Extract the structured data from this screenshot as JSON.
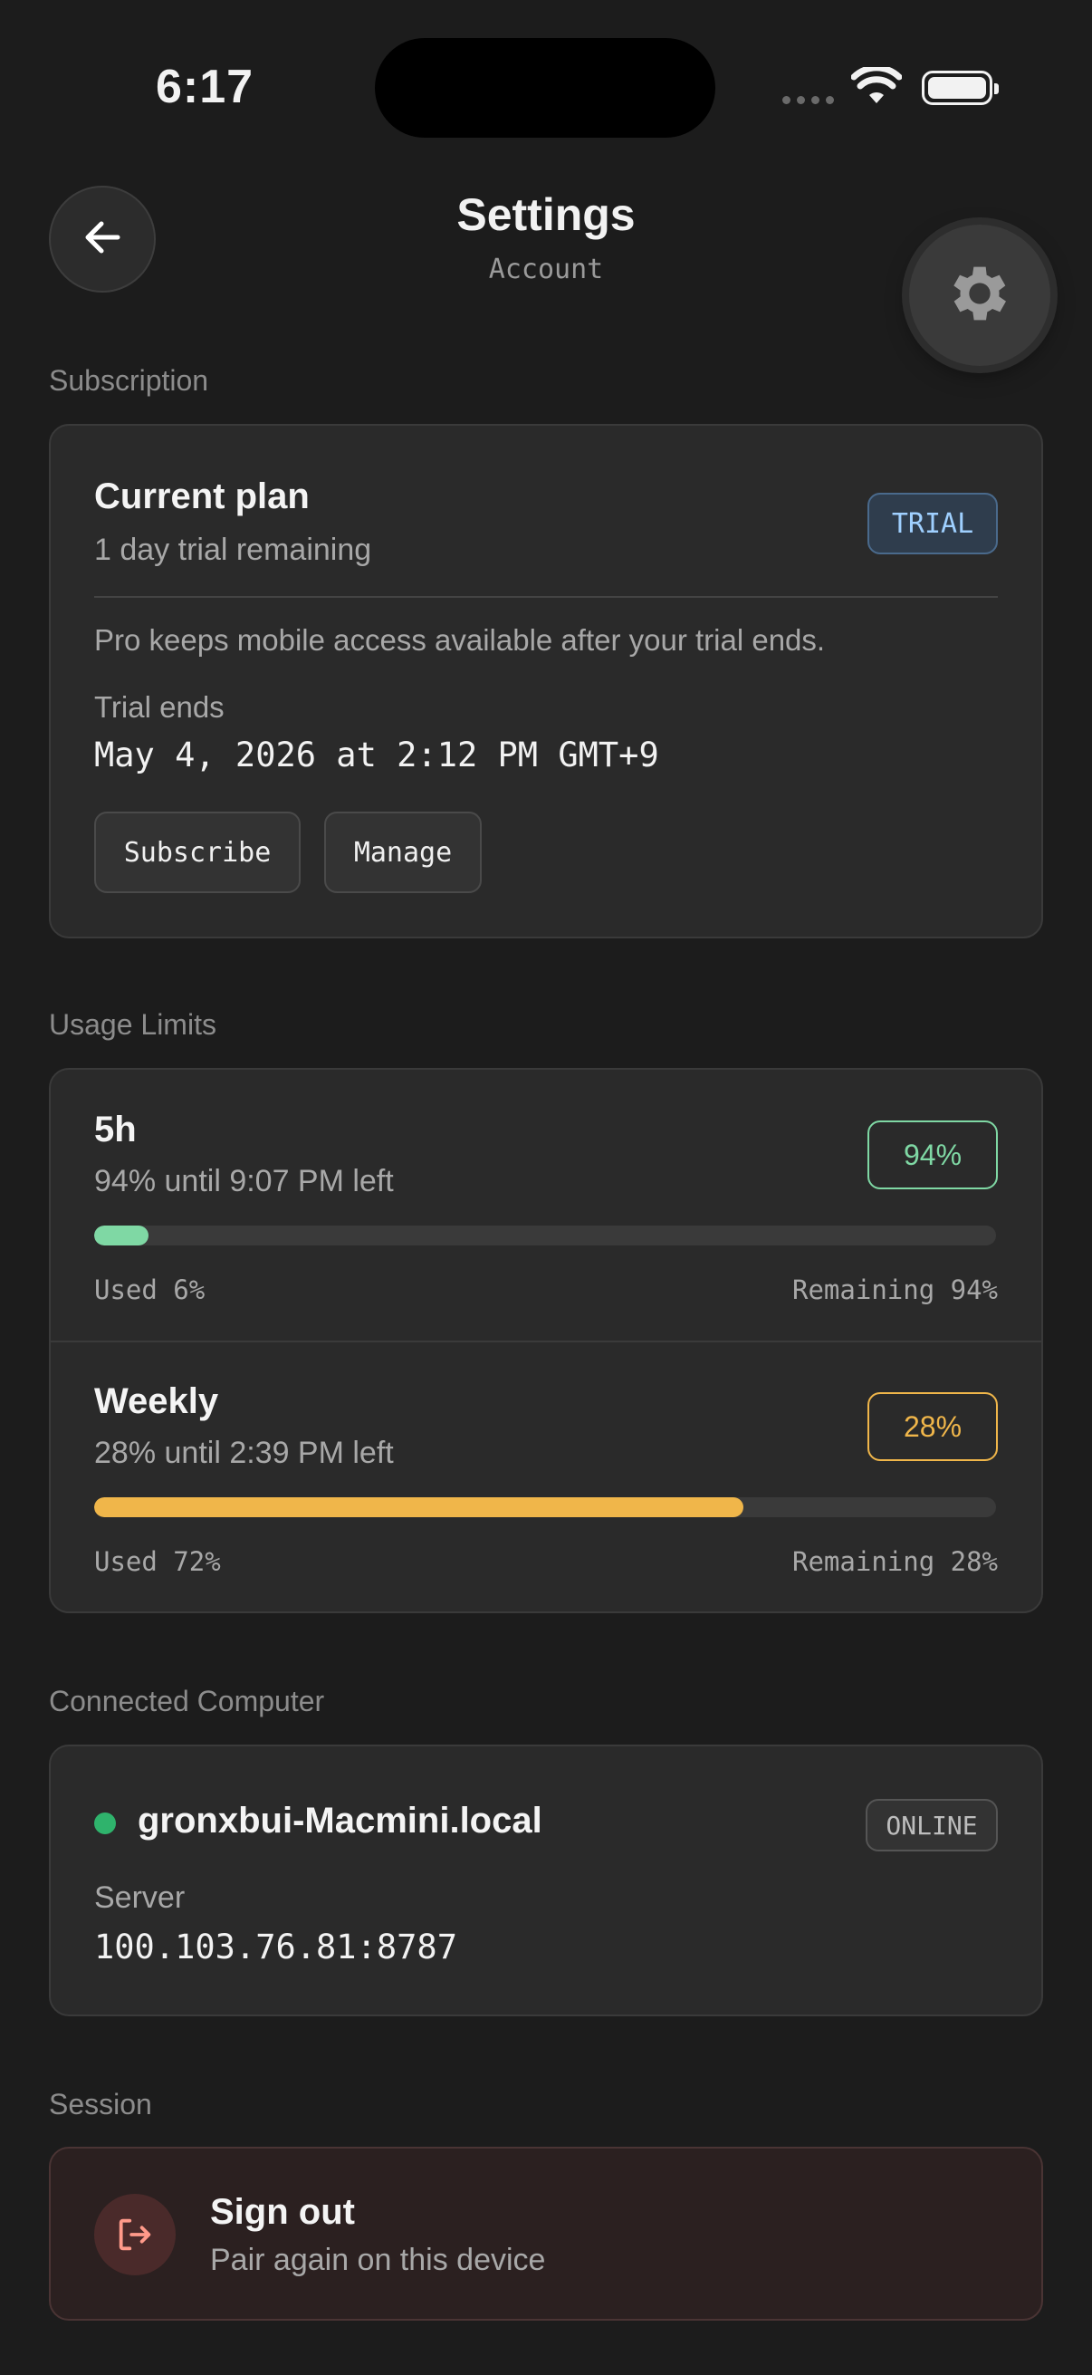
{
  "status_bar": {
    "time": "6:17"
  },
  "header": {
    "title": "Settings",
    "subtitle": "Account"
  },
  "subscription": {
    "section_label": "Subscription",
    "plan_title": "Current plan",
    "plan_subtitle": "1 day trial remaining",
    "badge": "TRIAL",
    "description": "Pro keeps mobile access available after your trial ends.",
    "trial_ends_label": "Trial ends",
    "trial_ends_value": "May 4, 2026 at 2:12 PM GMT+9",
    "subscribe_label": "Subscribe",
    "manage_label": "Manage"
  },
  "usage": {
    "section_label": "Usage Limits",
    "limits": [
      {
        "title": "5h",
        "subtitle": "94% until 9:07 PM left",
        "badge": "94%",
        "used_fraction": 0.06,
        "used_label": "Used 6%",
        "remaining_label": "Remaining 94%",
        "color": "#7fd8a4"
      },
      {
        "title": "Weekly",
        "subtitle": "28% until 2:39 PM left",
        "badge": "28%",
        "used_fraction": 0.72,
        "used_label": "Used 72%",
        "remaining_label": "Remaining 28%",
        "color": "#f0b64a"
      }
    ]
  },
  "computer": {
    "section_label": "Connected Computer",
    "hostname": "gronxbui-Macmini.local",
    "status_badge": "ONLINE",
    "status_color": "#2fb36c",
    "server_label": "Server",
    "server_value": "100.103.76.81:8787"
  },
  "session": {
    "section_label": "Session",
    "title": "Sign out",
    "subtitle": "Pair again on this device"
  },
  "colors": {
    "trial_badge_bg": "#2f3d4d",
    "trial_badge_text": "#9fd0ff",
    "signout_accent": "#ff9a8a"
  },
  "icons": {
    "back": "arrow-left-icon",
    "settings": "gear-icon",
    "signout": "logout-icon",
    "wifi": "wifi-icon",
    "battery": "battery-icon"
  }
}
